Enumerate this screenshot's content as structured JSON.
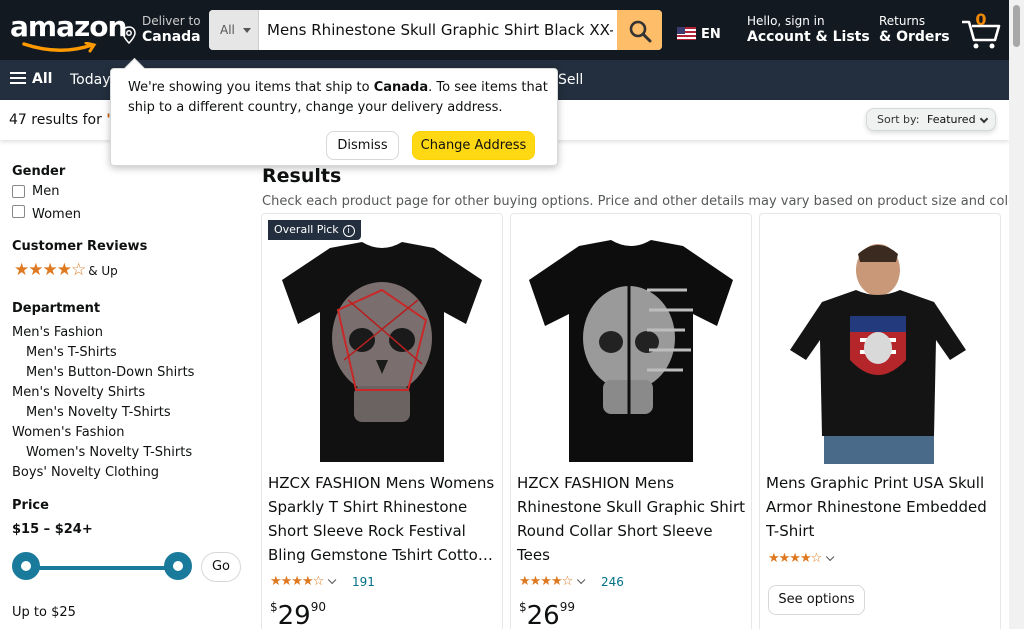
{
  "header": {
    "logo_text": "amazon",
    "deliver_label": "Deliver to",
    "deliver_location": "Canada",
    "search": {
      "category": "All",
      "query": "Mens Rhinestone Skull Graphic Shirt Black XX-Large"
    },
    "language": "EN",
    "account_line1": "Hello, sign in",
    "account_line2": "Account & Lists",
    "orders_line1": "Returns",
    "orders_line2": "& Orders",
    "cart_count": "0"
  },
  "subnav": {
    "all_label": "All",
    "today_label": "Today's",
    "sell_label": "Sell"
  },
  "popover": {
    "message_pre": "We're showing you items that ship to ",
    "message_bold": "Canada",
    "message_post": ". To see items that ship to a different country, change your delivery address.",
    "dismiss_label": "Dismiss",
    "change_label": "Change Address"
  },
  "results_bar": {
    "count_text": "47 results for ",
    "query_text": "\"M",
    "sort_label": "Sort by:",
    "sort_value": "Featured"
  },
  "sidebar": {
    "gender_heading": "Gender",
    "gender_options": [
      "Men",
      "Women"
    ],
    "reviews_heading": "Customer Reviews",
    "reviews_stars": "★★★★☆",
    "reviews_up": "& Up",
    "department_heading": "Department",
    "departments": [
      "Men's Fashion",
      "Men's T-Shirts",
      "Men's Button-Down Shirts",
      "Men's Novelty Shirts",
      "Men's Novelty T-Shirts",
      "Women's Fashion",
      "Women's Novelty T-Shirts",
      "Boys' Novelty Clothing"
    ],
    "price_heading": "Price",
    "price_range": "$15 – $24+",
    "go_label": "Go",
    "up_to": "Up to $25"
  },
  "results": {
    "heading": "Results",
    "subtext": "Check each product page for other buying options. Price and other details may vary based on product size and color.",
    "products": [
      {
        "badge": "Overall Pick",
        "badge_info": "i",
        "title": "HZCX FASHION Mens Womens Sparkly T Shirt Rhinestone Short Sleeve Rock Festival Bling Gemstone Tshirt Cotto…",
        "stars": "★★★★☆",
        "rating_count": "191",
        "price_whole": "29",
        "price_frac": "90"
      },
      {
        "title": "HZCX FASHION Mens Rhinestone Skull Graphic Shirt Round Collar Short Sleeve Tees",
        "stars": "★★★★☆",
        "rating_count": "246",
        "price_whole": "26",
        "price_frac": "99"
      },
      {
        "title": "Mens Graphic Print USA Skull Armor Rhinestone Embedded T-Shirt",
        "stars": "★★★★☆",
        "see_options": "See options"
      }
    ]
  }
}
